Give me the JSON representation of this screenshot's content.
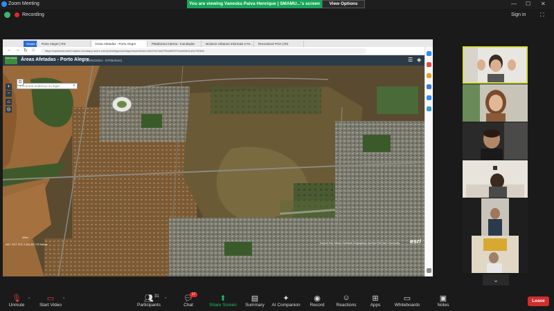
{
  "window": {
    "app_name": "Zoom Meeting",
    "banner": "You are viewing Vaneska Paiva Henrique | SMAMU...'s screen",
    "view_options": "View Options",
    "minimize": "—",
    "maximize": "☐",
    "close": "✕"
  },
  "recording": {
    "label": "Recording",
    "sign_in": "Sign in",
    "fullscreen": "⛶"
  },
  "browser": {
    "tabs": [
      {
        "label": "Grupo 2"
      },
      {
        "label": "Porto Alegre | RS"
      },
      {
        "label": "Áreas Afetadas - Porto Alegre"
      },
      {
        "label": "Plataforma Interna - Inundação"
      },
      {
        "label": "Núcleos Urbanos Informais e Fe..."
      },
      {
        "label": "Reconstruir POA | RS"
      }
    ],
    "url": "https://cadeenemote3.eastus.cloudapp.azure.com/portal/apps/webappviewer/index.html?id=3af47f84af9f4972aa045d1a2a75236b"
  },
  "app": {
    "logo_text": "Porto Alegre",
    "title": "Áreas Afetadas - Porto Alegre",
    "dates": "(19/04/2024 - 07/05/2024)",
    "search_placeholder": "Encontrar endereço ou lugar",
    "zoom_in": "+",
    "zoom_out": "−",
    "home": "⌂",
    "locate": "◎",
    "esri": "esri",
    "attribution": "Source: Esri, Maxar, Earthstar Geographics, and the GIS User Community",
    "coordinates": "MSC 2017 21.5 -1 484,302.729 Metros",
    "scale": "300m"
  },
  "gallery": {
    "scroll_down": "⌄"
  },
  "toolbar": {
    "unmute": "Unmute",
    "start_video": "Start Video",
    "participants": "Participants",
    "participants_count": "31",
    "chat": "Chat",
    "chat_badge": "17",
    "share_screen": "Share Screen",
    "summary": "Summary",
    "ai_companion": "AI Companion",
    "record": "Record",
    "reactions": "Reactions",
    "apps": "Apps",
    "whiteboards": "Whiteboards",
    "notes": "Notes",
    "leave": "Leave"
  },
  "colors": {
    "accent_green": "#19c162",
    "leave_red": "#d12e2e",
    "active_speaker": "#d6e04a",
    "flood_brown": "#8b5a2b"
  }
}
